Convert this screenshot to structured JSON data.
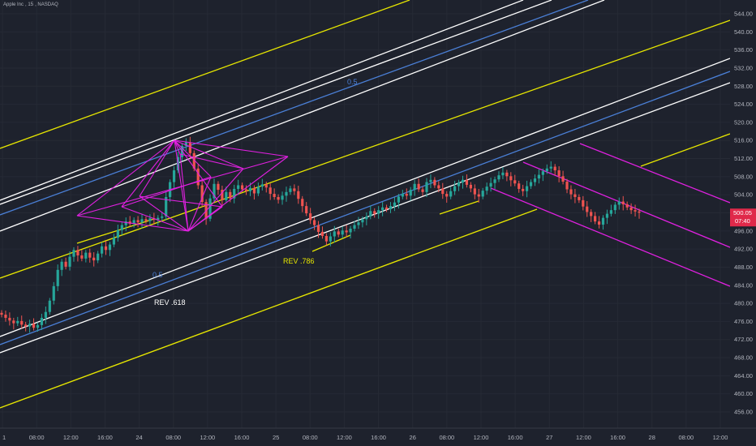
{
  "header": {
    "symbol_name": "Apple Inc",
    "interval": "15",
    "exchange": "NASDAQ"
  },
  "colors": {
    "background": "#1e222d",
    "grid": "#262a35",
    "up": "#26a69a",
    "down": "#ef5350",
    "yellow": "#e6e600",
    "white": "#ffffff",
    "blue": "#4a7fd6",
    "magenta": "#e020e0",
    "price_tag": "#e0294a"
  },
  "axes": {
    "price_ticks": [
      "544.00",
      "540.00",
      "536.00",
      "532.00",
      "528.00",
      "524.00",
      "520.00",
      "516.00",
      "512.00",
      "508.00",
      "504.00",
      "500.00",
      "496.00",
      "492.00",
      "488.00",
      "484.00",
      "480.00",
      "476.00",
      "472.00",
      "468.00",
      "464.00",
      "460.00",
      "456.00"
    ],
    "time_ticks": [
      "1",
      "08:00",
      "12:00",
      "16:00",
      "24",
      "08:00",
      "12:00",
      "16:00",
      "25",
      "08:00",
      "12:00",
      "16:00",
      "26",
      "08:00",
      "12:00",
      "16:00",
      "27",
      "12:00",
      "16:00",
      "28",
      "08:00",
      "12:00"
    ]
  },
  "current_price": {
    "price": "500.05",
    "countdown": "07:40"
  },
  "annotations": {
    "rev_618": "REV .618",
    "rev_786": "REV .786",
    "level_upper": "0.5",
    "level_lower": "0.5"
  },
  "chart_data": {
    "type": "candlestick",
    "symbol": "Apple Inc",
    "interval": "15",
    "exchange": "NASDAQ",
    "ylim": [
      454,
      548
    ],
    "last_price": 500.05,
    "closes": [
      477.5,
      476.8,
      476.2,
      475.6,
      476.1,
      475.3,
      474.9,
      475.5,
      474.6,
      475.2,
      476.8,
      478.1,
      480.6,
      483.8,
      487.4,
      489.2,
      488.1,
      490.3,
      491.8,
      490.6,
      489.9,
      491.2,
      490.1,
      489.5,
      491.0,
      492.6,
      491.8,
      493.0,
      494.5,
      496.2,
      497.3,
      498.1,
      497.6,
      498.4,
      497.9,
      498.6,
      498.2,
      498.8,
      498.5,
      498.9,
      499.2,
      503.5,
      506.8,
      509.4,
      512.3,
      514.8,
      515.6,
      513.2,
      509.8,
      506.1,
      502.4,
      498.7,
      503.2,
      506.4,
      505.1,
      502.8,
      504.6,
      503.2,
      505.3,
      506.1,
      505.2,
      504.8,
      505.5,
      504.3,
      505.8,
      506.3,
      505.6,
      504.2,
      503.5,
      502.9,
      503.8,
      504.6,
      505.4,
      504.8,
      503.1,
      501.5,
      499.9,
      498.4,
      497.3,
      495.8,
      494.9,
      493.7,
      494.8,
      495.9,
      495.2,
      496.1,
      495.7,
      496.5,
      497.3,
      497.9,
      498.6,
      499.2,
      500.4,
      499.8,
      500.6,
      501.2,
      500.8,
      501.5,
      502.3,
      503.6,
      504.2,
      503.8,
      505.1,
      506.4,
      505.2,
      504.6,
      506.8,
      507.3,
      506.1,
      505.4,
      504.2,
      503.6,
      504.8,
      505.9,
      506.7,
      507.3,
      506.2,
      505.4,
      504.1,
      503.6,
      504.9,
      505.8,
      506.6,
      507.4,
      508.3,
      508.9,
      508.1,
      507.2,
      506.5,
      505.3,
      504.8,
      505.9,
      506.8,
      507.6,
      508.4,
      509.2,
      509.8,
      510.2,
      509.4,
      508.1,
      506.9,
      505.2,
      504.1,
      503.5,
      502.8,
      501.4,
      500.2,
      499.3,
      498.1,
      497.4,
      498.9,
      499.8,
      500.6,
      501.8,
      502.5,
      501.9,
      501.2,
      500.6,
      500.3,
      500.05
    ]
  }
}
